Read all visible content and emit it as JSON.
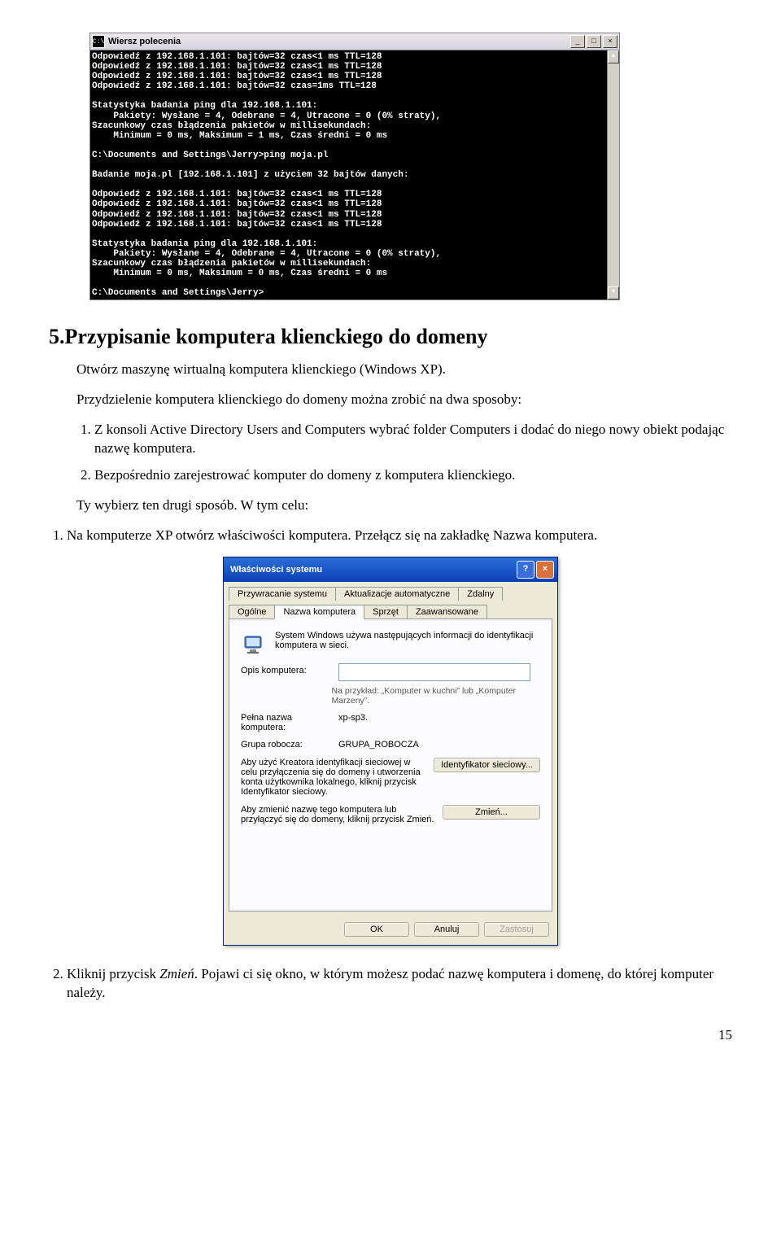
{
  "cmd": {
    "title": "Wiersz polecenia",
    "icon_label": "C:\\",
    "lines": [
      "Odpowiedź z 192.168.1.101: bajtów=32 czas<1 ms TTL=128",
      "Odpowiedź z 192.168.1.101: bajtów=32 czas<1 ms TTL=128",
      "Odpowiedź z 192.168.1.101: bajtów=32 czas<1 ms TTL=128",
      "Odpowiedź z 192.168.1.101: bajtów=32 czas=1ms TTL=128",
      "",
      "Statystyka badania ping dla 192.168.1.101:",
      "    Pakiety: Wysłane = 4, Odebrane = 4, Utracone = 0 (0% straty),",
      "Szacunkowy czas błądzenia pakietów w millisekundach:",
      "    Minimum = 0 ms, Maksimum = 1 ms, Czas średni = 0 ms",
      "",
      "C:\\Documents and Settings\\Jerry>ping moja.pl",
      "",
      "Badanie moja.pl [192.168.1.101] z użyciem 32 bajtów danych:",
      "",
      "Odpowiedź z 192.168.1.101: bajtów=32 czas<1 ms TTL=128",
      "Odpowiedź z 192.168.1.101: bajtów=32 czas<1 ms TTL=128",
      "Odpowiedź z 192.168.1.101: bajtów=32 czas<1 ms TTL=128",
      "Odpowiedź z 192.168.1.101: bajtów=32 czas<1 ms TTL=128",
      "",
      "Statystyka badania ping dla 192.168.1.101:",
      "    Pakiety: Wysłane = 4, Odebrane = 4, Utracone = 0 (0% straty),",
      "Szacunkowy czas błądzenia pakietów w millisekundach:",
      "    Minimum = 0 ms, Maksimum = 0 ms, Czas średni = 0 ms",
      "",
      "C:\\Documents and Settings\\Jerry>"
    ]
  },
  "doc": {
    "heading": "5.Przypisanie komputera klienckiego do domeny",
    "p1": "Otwórz maszynę wirtualną komputera klienckiego (Windows XP).",
    "p2": "Przydzielenie komputera klienckiego do domeny można zrobić na dwa sposoby:",
    "ways": {
      "a": "Z konsoli Active Directory Users and Computers wybrać folder Computers i dodać do niego nowy obiekt podając nazwę komputera.",
      "b": "Bezpośrednio zarejestrować komputer do domeny z komputera klienckiego."
    },
    "p3": "Ty wybierz ten drugi sposób. W tym celu:",
    "step1": "Na komputerze XP otwórz właściwości komputera. Przełącz się na zakładkę Nazwa komputera.",
    "step2_a": "Kliknij przycisk ",
    "step2_em": "Zmień",
    "step2_b": ". Pojawi ci się okno, w którym możesz podać nazwę komputera i domenę, do której komputer należy."
  },
  "sysprop": {
    "title": "Właściwości systemu",
    "tabs_row1": {
      "a": "Przywracanie systemu",
      "b": "Aktualizacje automatyczne",
      "c": "Zdalny"
    },
    "tabs_row2": {
      "a": "Ogólne",
      "b": "Nazwa komputera",
      "c": "Sprzęt",
      "d": "Zaawansowane"
    },
    "desc": "System Windows używa następujących informacji do identyfikacji komputera w sieci.",
    "opis_label": "Opis komputera:",
    "opis_hint": "Na przykład: „Komputer w kuchni” lub „Komputer Marzeny”.",
    "fullname_label": "Pełna nazwa komputera:",
    "fullname_value": "xp-sp3.",
    "workgroup_label": "Grupa robocza:",
    "workgroup_value": "GRUPA_ROBOCZA",
    "wizard_text": "Aby użyć Kreatora identyfikacji sieciowej w celu przyłączenia się do domeny i utworzenia konta użytkownika lokalnego, kliknij przycisk Identyfikator sieciowy.",
    "wizard_btn": "Identyfikator sieciowy...",
    "change_text": "Aby zmienić nazwę tego komputera lub przyłączyć się do domeny, kliknij przycisk Zmień.",
    "change_btn": "Zmień...",
    "ok": "OK",
    "cancel": "Anuluj",
    "apply": "Zastosuj"
  },
  "page_number": "15"
}
